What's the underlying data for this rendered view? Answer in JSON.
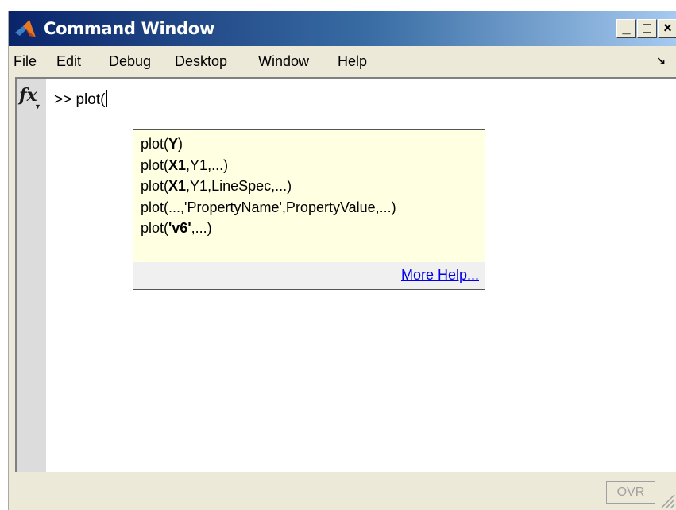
{
  "window": {
    "title": "Command Window",
    "icon": "matlab-logo-icon",
    "controls": {
      "minimize": "_",
      "maximize": "□",
      "close": "×"
    }
  },
  "menu": {
    "items": [
      "File",
      "Edit",
      "Debug",
      "Desktop",
      "Window",
      "Help"
    ],
    "undock_icon": "↘"
  },
  "command": {
    "fx_label": "fx",
    "prompt": ">>",
    "input": "plot("
  },
  "hint": {
    "lines": [
      {
        "pre": "plot(",
        "bold": "Y",
        "post": ")"
      },
      {
        "pre": "plot(",
        "bold": "X1",
        "post": ",Y1,...)"
      },
      {
        "pre": "plot(",
        "bold": "X1",
        "post": ",Y1,LineSpec,...)"
      },
      {
        "pre": "plot(...,'PropertyName',PropertyValue,...)",
        "bold": "",
        "post": ""
      },
      {
        "pre": "plot(",
        "bold": "'v6'",
        "post": ",...)"
      }
    ],
    "more_help": "More Help..."
  },
  "status": {
    "ovr": "OVR"
  },
  "colors": {
    "titlebar_start": "#0a246a",
    "titlebar_end": "#a6caf0",
    "hint_background": "#ffffe1",
    "link": "#0000ee"
  }
}
